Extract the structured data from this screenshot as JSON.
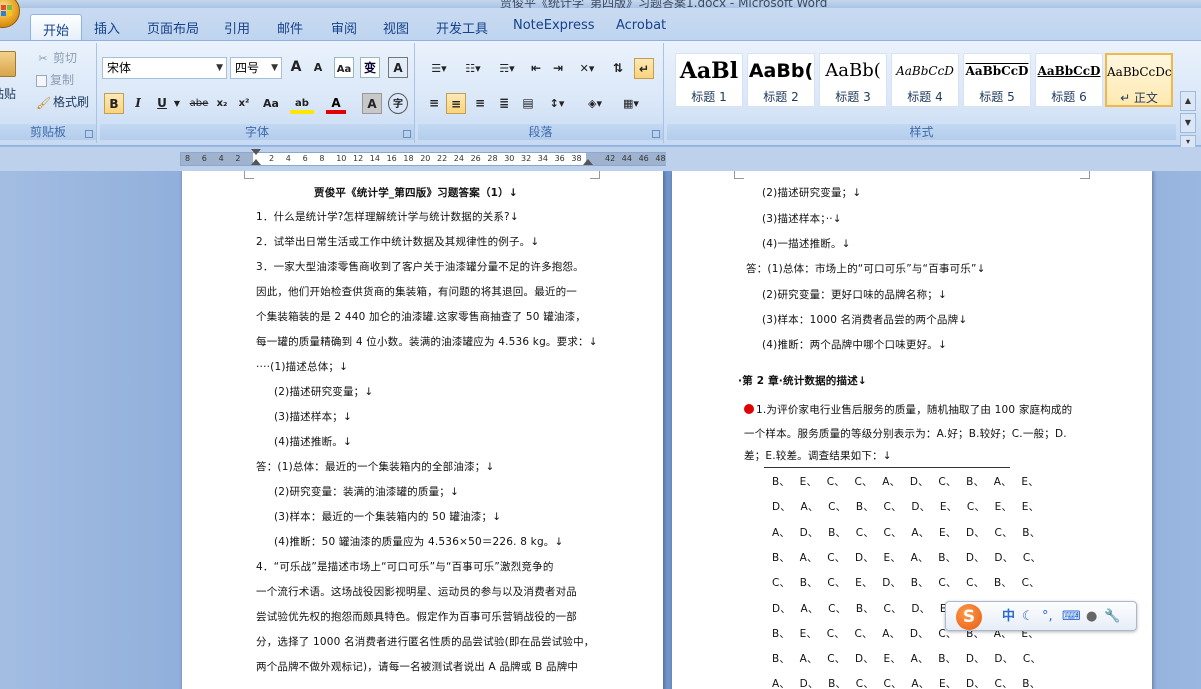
{
  "window": {
    "title": "贾俊平《统计学_第四版》习题答案1.docx - Microsoft Word"
  },
  "tabs": [
    {
      "label": "开始",
      "active": true
    },
    {
      "label": "插入"
    },
    {
      "label": "页面布局"
    },
    {
      "label": "引用"
    },
    {
      "label": "邮件"
    },
    {
      "label": "审阅"
    },
    {
      "label": "视图"
    },
    {
      "label": "开发工具"
    },
    {
      "label": "NoteExpress"
    },
    {
      "label": "Acrobat"
    }
  ],
  "clipboard": {
    "paste": "粘贴",
    "cut": "剪切",
    "copy": "复制",
    "format_painter": "格式刷",
    "label": "剪贴板"
  },
  "font": {
    "name": "宋体",
    "size": "四号",
    "label": "字体",
    "grow": "A",
    "shrink": "A",
    "bold": "B",
    "italic": "I",
    "underline": "U",
    "strike": "abe",
    "subscript": "x₂",
    "superscript": "x²",
    "case": "Aa",
    "phonetic": "变",
    "border_char": "A",
    "clear_format": "A",
    "highlight": "ab",
    "color": "A",
    "shade": "A",
    "enclose": "字"
  },
  "paragraph": {
    "label": "段落"
  },
  "styles": {
    "label": "样式",
    "items": [
      {
        "sample": "AaBl",
        "label": "标题 1"
      },
      {
        "sample": "AaBb(",
        "label": "标题 2"
      },
      {
        "sample": "AaBb(",
        "label": "标题 3"
      },
      {
        "sample": "AaBbCcD",
        "label": "标题 4"
      },
      {
        "sample": "AaBbCcD",
        "label": "标题 5"
      },
      {
        "sample": "AaBbCcD",
        "label": "标题 6"
      },
      {
        "sample": "AaBbCcDc",
        "label": "↵ 正文",
        "selected": true
      }
    ]
  },
  "ruler": {
    "ticks": [
      "8",
      "6",
      "4",
      "2",
      "",
      "2",
      "4",
      "6",
      "8",
      "10",
      "12",
      "14",
      "16",
      "18",
      "20",
      "22",
      "24",
      "26",
      "28",
      "30",
      "32",
      "34",
      "36",
      "38",
      "",
      "42",
      "44",
      "46",
      "48"
    ]
  },
  "page1": {
    "lines": [
      {
        "text": "贾俊平《统计学_第四版》习题答案（1）↓",
        "bold": true
      },
      {
        "text": "1．什么是统计学?怎样理解统计学与统计数据的关系?↓"
      },
      {
        "text": "2．试举出日常生活或工作中统计数据及其规律性的例子。↓"
      },
      {
        "text": "3．一家大型油漆零售商收到了客户关于油漆罐分量不足的许多抱怨。"
      },
      {
        "text": "因此，他们开始检查供货商的集装箱，有问题的将其退回。最近的一"
      },
      {
        "text": "个集装箱装的是 2 440 加仑的油漆罐.这家零售商抽查了 50 罐油漆，"
      },
      {
        "text": "每一罐的质量精确到 4 位小数。装满的油漆罐应为 4.536 kg。要求：↓"
      },
      {
        "text": "····(1)描述总体；↓"
      },
      {
        "text": "(2)描述研究变量；↓"
      },
      {
        "text": "(3)描述样本；↓"
      },
      {
        "text": "(4)描述推断。↓"
      },
      {
        "text": "答：(1)总体：最近的一个集装箱内的全部油漆；↓"
      },
      {
        "text": "(2)研究变量：装满的油漆罐的质量；↓"
      },
      {
        "text": "(3)样本：最近的一个集装箱内的 50 罐油漆；↓"
      },
      {
        "text": "(4)推断：50 罐油漆的质量应为 4.536×50＝226. 8 kg。↓"
      },
      {
        "text": "4．“可乐战”是描述市场上“可口可乐”与“百事可乐”激烈竞争的"
      },
      {
        "text": "一个流行术语。这场战役因影视明星、运动员的参与以及消费者对品"
      },
      {
        "text": "尝试验优先权的抱怨而颇具特色。假定作为百事可乐营销战役的一部"
      },
      {
        "text": "分，选择了 1000 名消费者进行匿名性质的品尝试验(即在品尝试验中，"
      },
      {
        "text": "两个品牌不做外观标记)，请每一名被测试者说出 A 品牌或 B 品牌中"
      }
    ]
  },
  "page2": {
    "lines": [
      {
        "text": "(2)描述研究变量；↓"
      },
      {
        "text": "(3)描述样本；··↓"
      },
      {
        "text": "(4)一描述推断。↓"
      },
      {
        "text": "答：(1)总体：市场上的“可口可乐”与“百事可乐”↓"
      },
      {
        "text": "(2)研究变量：更好口味的品牌名称；↓"
      },
      {
        "text": "(3)样本：1000 名消费者品尝的两个品牌↓"
      },
      {
        "text": "(4)推断：两个品牌中哪个口味更好。↓"
      },
      {
        "text": "·第 2 章·统计数据的描述↓",
        "bold": true
      },
      {
        "text": "1.为评价家电行业售后服务的质量，随机抽取了由 100 家庭构成的",
        "bullet": true
      },
      {
        "text": "一个样本。服务质量的等级分别表示为：A.好；B.较好；C.一般；D."
      },
      {
        "text": "差；E.较差。调查结果如下：↓"
      }
    ],
    "grid": [
      "B、 E、 C、 C、 A、 D、 C、 B、 A、 E、",
      "D、 A、 C、 B、 C、 D、 E、 C、 E、 E、",
      "A、 D、 B、 C、 C、 A、 E、 D、 C、 B、",
      "B、 A、 C、 D、 E、 A、 B、 D、 D、 C、",
      "C、 B、 C、 E、 D、 B、 C、 C、 B、 C、",
      "D、 A、 C、 B、 C、 D、 E、",
      "B、 E、 C、 C、 A、 D、 C、 B、 A、 E、",
      "B、 A、 C、 D、 E、 A、 B、 D、 D、 C、",
      "A、 D、 B、 C、 C、 A、 E、 D、 C、 B、"
    ]
  },
  "ime": {
    "mode": "中",
    "logo": "S"
  },
  "colors": {
    "ribbon_text": "#15428b",
    "accent_orange": "#f0b84a",
    "red_bullet": "#e00000"
  }
}
